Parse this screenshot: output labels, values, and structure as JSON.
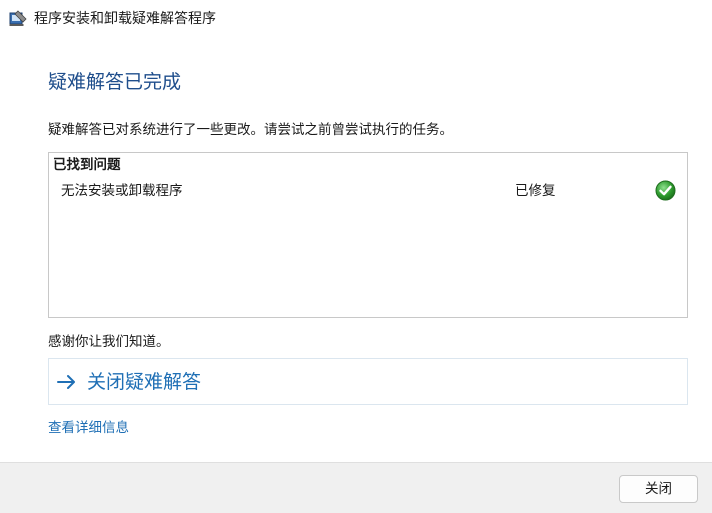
{
  "window": {
    "title": "程序安装和卸载疑难解答程序"
  },
  "main": {
    "heading": "疑难解答已完成",
    "description": "疑难解答已对系统进行了一些更改。请尝试之前曾尝试执行的任务。",
    "problems": {
      "header": "已找到问题",
      "items": [
        {
          "name": "无法安装或卸载程序",
          "status": "已修复",
          "status_icon": "check-icon"
        }
      ]
    },
    "thanks": "感谢你让我们知道。",
    "close_troubleshooter_label": "关闭疑难解答",
    "details_link": "查看详细信息"
  },
  "footer": {
    "close_button_label": "关闭"
  },
  "colors": {
    "heading": "#1f4e8c",
    "link": "#1f6fb5",
    "check_green": "#2e9b2e",
    "footer_bg": "#f0f0f0"
  }
}
